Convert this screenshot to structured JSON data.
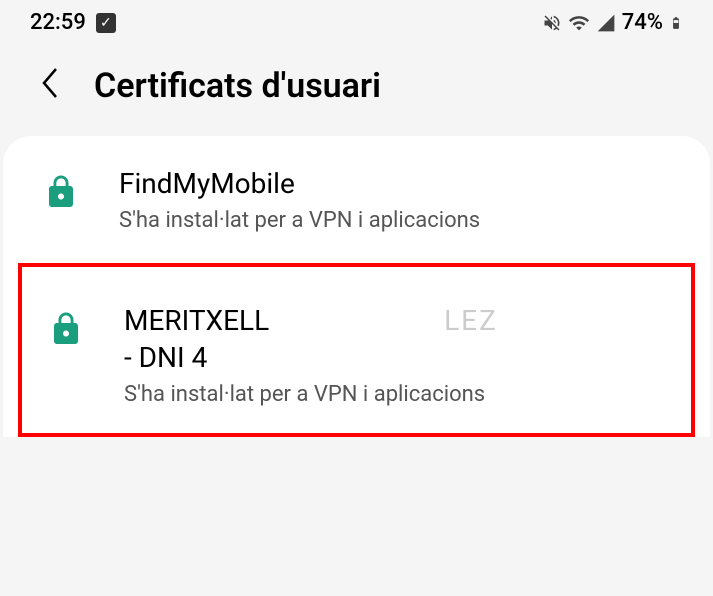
{
  "status_bar": {
    "time": "22:59",
    "battery_percent": "74%"
  },
  "header": {
    "title": "Certificats d'usuari"
  },
  "certificates": [
    {
      "name": "FindMyMobile",
      "subtitle": "S'ha instal·lat per a VPN i aplicacions",
      "highlighted": false
    },
    {
      "name_line1": "MERITXELL",
      "name_line1_redacted": "LEZ",
      "name_line2": "- DNI 4",
      "subtitle": "S'ha instal·lat per a VPN i aplicacions",
      "highlighted": true
    }
  ]
}
